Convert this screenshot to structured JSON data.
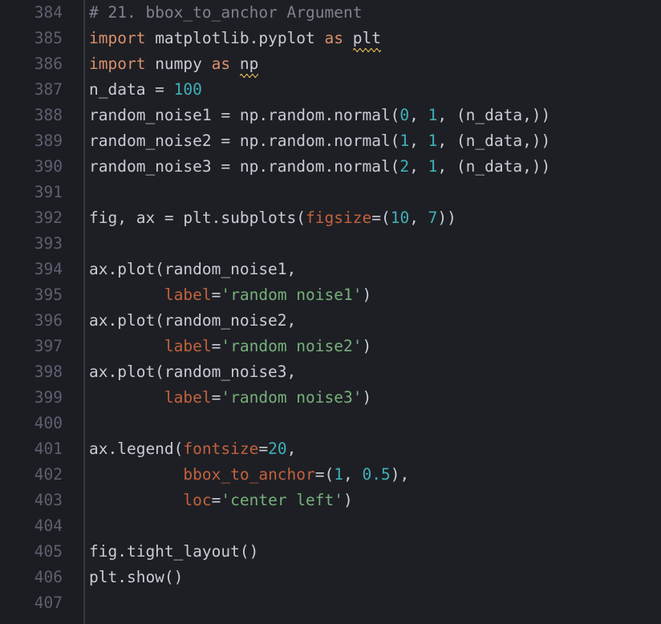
{
  "editor": {
    "first_line_number": 384,
    "line_height": 32,
    "char_width": 14.1,
    "colors": {
      "background": "#1e1f25",
      "gutter_background": "#1c1d22",
      "gutter_divider": "#35373f",
      "line_number": "#5c6070",
      "plain_text": "#c9ccd4",
      "comment": "#7e828e",
      "keyword": "#d9906a",
      "kwarg": "#c2623c",
      "number": "#3fb0b8",
      "string": "#76b07a",
      "squiggle": "#d8b250"
    }
  },
  "lines": [
    {
      "number": "384",
      "tokens": [
        {
          "text": "# 21. bbox_to_anchor Argument",
          "type": "comment"
        }
      ]
    },
    {
      "number": "385",
      "tokens": [
        {
          "text": "import",
          "type": "keyword"
        },
        {
          "text": " matplotlib.pyplot ",
          "type": "plain"
        },
        {
          "text": "as",
          "type": "keyword"
        },
        {
          "text": " ",
          "type": "plain"
        },
        {
          "text": "plt",
          "type": "plain",
          "squiggle": true
        }
      ]
    },
    {
      "number": "386",
      "tokens": [
        {
          "text": "import",
          "type": "keyword"
        },
        {
          "text": " numpy ",
          "type": "plain"
        },
        {
          "text": "as",
          "type": "keyword"
        },
        {
          "text": " ",
          "type": "plain"
        },
        {
          "text": "np",
          "type": "plain",
          "squiggle": true
        }
      ]
    },
    {
      "number": "387",
      "tokens": [
        {
          "text": "n_data = ",
          "type": "plain"
        },
        {
          "text": "100",
          "type": "number"
        }
      ]
    },
    {
      "number": "388",
      "tokens": [
        {
          "text": "random_noise1 = np.random.normal(",
          "type": "plain"
        },
        {
          "text": "0",
          "type": "number"
        },
        {
          "text": ", ",
          "type": "plain"
        },
        {
          "text": "1",
          "type": "number"
        },
        {
          "text": ", (n_data,))",
          "type": "plain"
        }
      ]
    },
    {
      "number": "389",
      "tokens": [
        {
          "text": "random_noise2 = np.random.normal(",
          "type": "plain"
        },
        {
          "text": "1",
          "type": "number"
        },
        {
          "text": ", ",
          "type": "plain"
        },
        {
          "text": "1",
          "type": "number"
        },
        {
          "text": ", (n_data,))",
          "type": "plain"
        }
      ]
    },
    {
      "number": "390",
      "tokens": [
        {
          "text": "random_noise3 = np.random.normal(",
          "type": "plain"
        },
        {
          "text": "2",
          "type": "number"
        },
        {
          "text": ", ",
          "type": "plain"
        },
        {
          "text": "1",
          "type": "number"
        },
        {
          "text": ", (n_data,))",
          "type": "plain"
        }
      ]
    },
    {
      "number": "391",
      "tokens": []
    },
    {
      "number": "392",
      "tokens": [
        {
          "text": "fig, ax = plt.subplots(",
          "type": "plain"
        },
        {
          "text": "figsize",
          "type": "kwarg"
        },
        {
          "text": "=(",
          "type": "plain"
        },
        {
          "text": "10",
          "type": "number"
        },
        {
          "text": ", ",
          "type": "plain"
        },
        {
          "text": "7",
          "type": "number"
        },
        {
          "text": "))",
          "type": "plain"
        }
      ]
    },
    {
      "number": "393",
      "tokens": []
    },
    {
      "number": "394",
      "tokens": [
        {
          "text": "ax.plot(random_noise1,",
          "type": "plain"
        }
      ]
    },
    {
      "number": "395",
      "tokens": [
        {
          "text": "        ",
          "type": "plain"
        },
        {
          "text": "label",
          "type": "kwarg"
        },
        {
          "text": "=",
          "type": "plain"
        },
        {
          "text": "'random noise1'",
          "type": "string"
        },
        {
          "text": ")",
          "type": "plain"
        }
      ]
    },
    {
      "number": "396",
      "tokens": [
        {
          "text": "ax.plot(random_noise2,",
          "type": "plain"
        }
      ]
    },
    {
      "number": "397",
      "tokens": [
        {
          "text": "        ",
          "type": "plain"
        },
        {
          "text": "label",
          "type": "kwarg"
        },
        {
          "text": "=",
          "type": "plain"
        },
        {
          "text": "'random noise2'",
          "type": "string"
        },
        {
          "text": ")",
          "type": "plain"
        }
      ]
    },
    {
      "number": "398",
      "tokens": [
        {
          "text": "ax.plot(random_noise3,",
          "type": "plain"
        }
      ]
    },
    {
      "number": "399",
      "tokens": [
        {
          "text": "        ",
          "type": "plain"
        },
        {
          "text": "label",
          "type": "kwarg"
        },
        {
          "text": "=",
          "type": "plain"
        },
        {
          "text": "'random noise3'",
          "type": "string"
        },
        {
          "text": ")",
          "type": "plain"
        }
      ]
    },
    {
      "number": "400",
      "tokens": []
    },
    {
      "number": "401",
      "tokens": [
        {
          "text": "ax.legend(",
          "type": "plain"
        },
        {
          "text": "fontsize",
          "type": "kwarg"
        },
        {
          "text": "=",
          "type": "plain"
        },
        {
          "text": "20",
          "type": "number"
        },
        {
          "text": ",",
          "type": "plain"
        }
      ]
    },
    {
      "number": "402",
      "tokens": [
        {
          "text": "          ",
          "type": "plain"
        },
        {
          "text": "bbox_to_anchor",
          "type": "kwarg"
        },
        {
          "text": "=(",
          "type": "plain"
        },
        {
          "text": "1",
          "type": "number"
        },
        {
          "text": ", ",
          "type": "plain"
        },
        {
          "text": "0.5",
          "type": "number"
        },
        {
          "text": "),",
          "type": "plain"
        }
      ]
    },
    {
      "number": "403",
      "tokens": [
        {
          "text": "          ",
          "type": "plain"
        },
        {
          "text": "loc",
          "type": "kwarg"
        },
        {
          "text": "=",
          "type": "plain"
        },
        {
          "text": "'center left'",
          "type": "string"
        },
        {
          "text": ")",
          "type": "plain"
        }
      ]
    },
    {
      "number": "404",
      "tokens": []
    },
    {
      "number": "405",
      "tokens": [
        {
          "text": "fig.tight_layout()",
          "type": "plain"
        }
      ]
    },
    {
      "number": "406",
      "tokens": [
        {
          "text": "plt.show()",
          "type": "plain"
        }
      ]
    },
    {
      "number": "407",
      "tokens": []
    }
  ]
}
